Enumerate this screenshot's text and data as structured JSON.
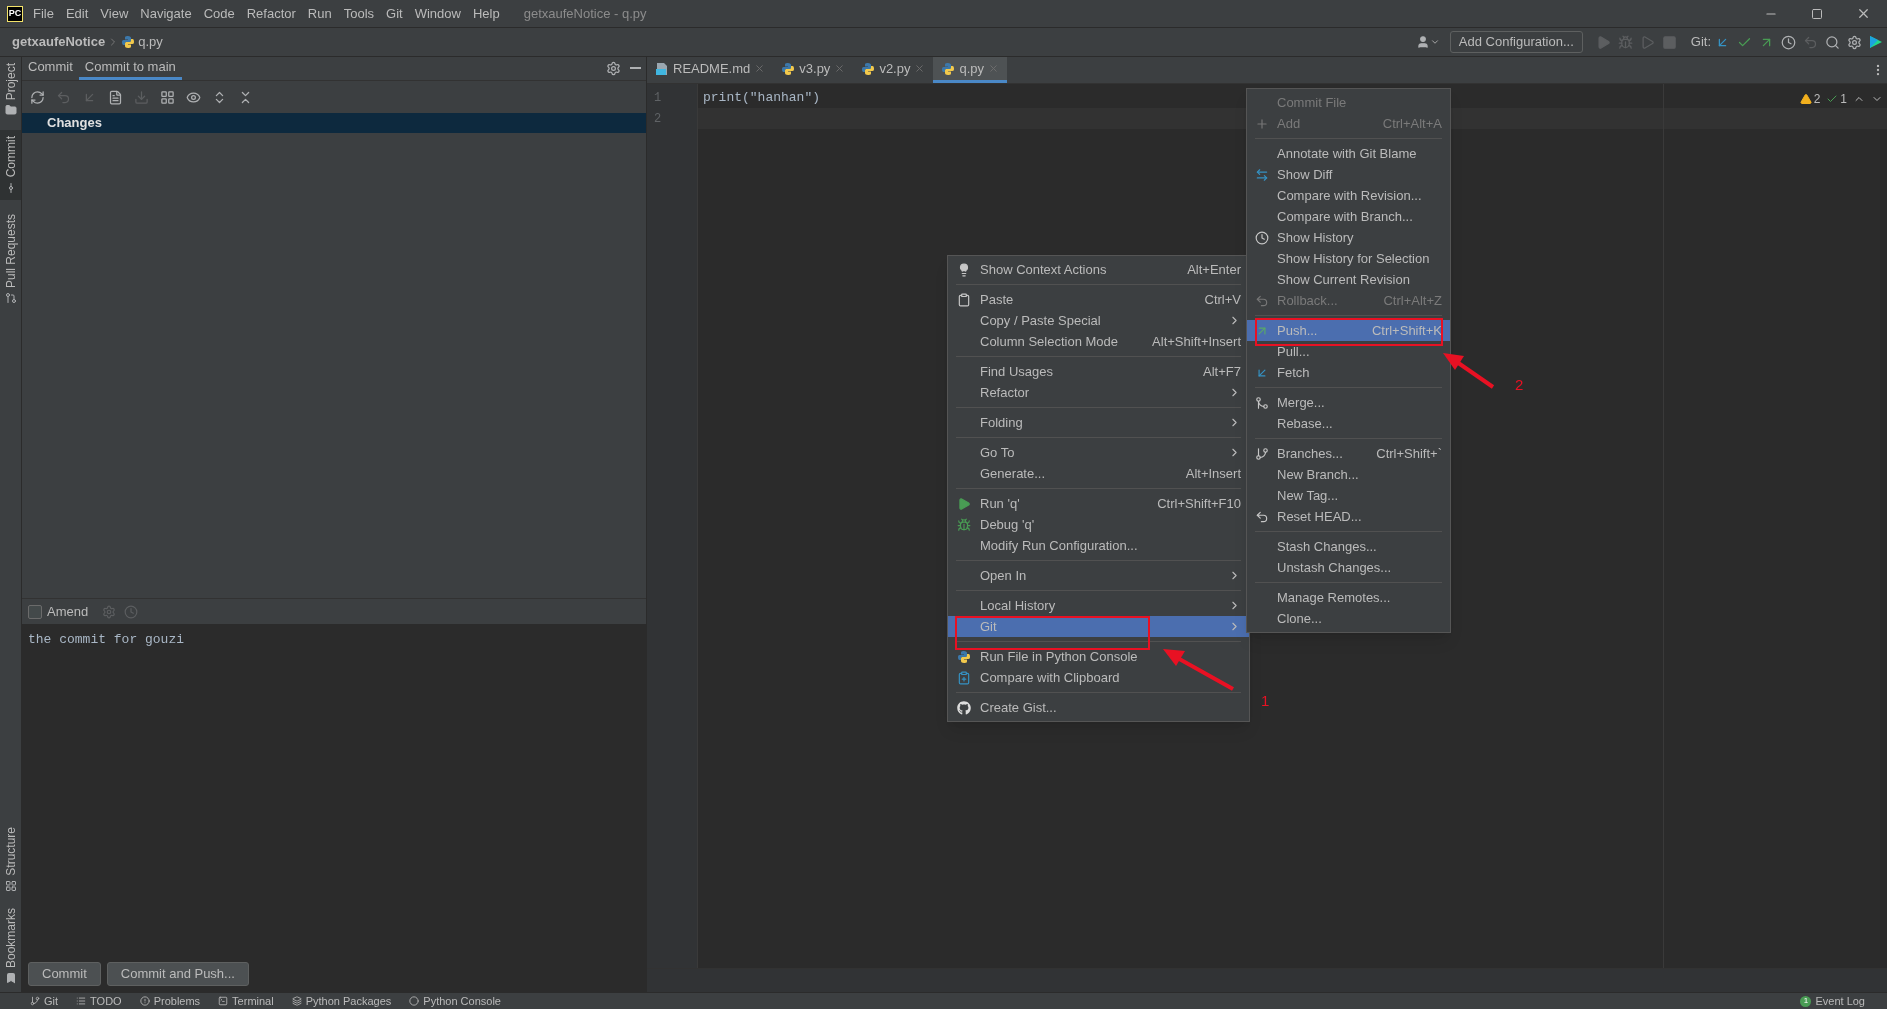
{
  "window": {
    "app_logo": "PC",
    "title": "getxaufeNotice - q.py"
  },
  "menu_bar": [
    "File",
    "Edit",
    "View",
    "Navigate",
    "Code",
    "Refactor",
    "Run",
    "Tools",
    "Git",
    "Window",
    "Help"
  ],
  "breadcrumb": [
    "getxaufeNotice",
    "q.py"
  ],
  "toolbar": {
    "run_config_button": "Add Configuration...",
    "vcs_label": "Git:"
  },
  "side_stripe": {
    "top": [
      {
        "label": "Project",
        "selected": false
      },
      {
        "label": "Commit",
        "selected": true
      },
      {
        "label": "Pull Requests",
        "selected": false
      }
    ],
    "bottom": [
      {
        "label": "Structure",
        "selected": false
      },
      {
        "label": "Bookmarks",
        "selected": false
      }
    ]
  },
  "commit_panel": {
    "tabs": [
      {
        "label": "Commit",
        "selected": false
      },
      {
        "label": "Commit to main",
        "selected": true
      }
    ],
    "tree": [
      {
        "label": "Changes",
        "selected": true
      }
    ],
    "amend": {
      "label": "Amend",
      "checked": false
    },
    "message": "the commit for gouzi",
    "buttons": [
      "Commit",
      "Commit and Push..."
    ]
  },
  "editor": {
    "tabs": [
      {
        "label": "README.md",
        "kind": "markdown",
        "selected": false
      },
      {
        "label": "v3.py",
        "kind": "python",
        "selected": false
      },
      {
        "label": "v2.py",
        "kind": "python",
        "selected": false
      },
      {
        "label": "q.py",
        "kind": "python",
        "selected": true
      }
    ],
    "line_numbers": [
      "1",
      "2"
    ],
    "code": [
      "print(\"hanhan\")"
    ],
    "inspections": {
      "warnings": "2",
      "weak_warnings": "1"
    }
  },
  "context_menu": {
    "groups": [
      [
        {
          "label": "Show Context Actions",
          "shortcut": "Alt+Enter",
          "submenu": false,
          "disabled": false,
          "selected": false
        }
      ],
      [
        {
          "label": "Paste",
          "shortcut": "Ctrl+V",
          "submenu": false,
          "disabled": false,
          "selected": false
        },
        {
          "label": "Copy / Paste Special",
          "submenu": true,
          "disabled": false,
          "selected": false
        },
        {
          "label": "Column Selection Mode",
          "shortcut": "Alt+Shift+Insert",
          "submenu": false,
          "disabled": false,
          "selected": false
        }
      ],
      [
        {
          "label": "Find Usages",
          "shortcut": "Alt+F7",
          "submenu": false,
          "disabled": false,
          "selected": false
        },
        {
          "label": "Refactor",
          "submenu": true,
          "disabled": false,
          "selected": false
        }
      ],
      [
        {
          "label": "Folding",
          "submenu": true,
          "disabled": false,
          "selected": false
        }
      ],
      [
        {
          "label": "Go To",
          "submenu": true,
          "disabled": false,
          "selected": false
        },
        {
          "label": "Generate...",
          "shortcut": "Alt+Insert",
          "submenu": false,
          "disabled": false,
          "selected": false
        }
      ],
      [
        {
          "label": "Run 'q'",
          "shortcut": "Ctrl+Shift+F10",
          "submenu": false,
          "disabled": false,
          "selected": false
        },
        {
          "label": "Debug 'q'",
          "submenu": false,
          "disabled": false,
          "selected": false
        },
        {
          "label": "Modify Run Configuration...",
          "submenu": false,
          "disabled": false,
          "selected": false
        }
      ],
      [
        {
          "label": "Open In",
          "submenu": true,
          "disabled": false,
          "selected": false
        }
      ],
      [
        {
          "label": "Local History",
          "submenu": true,
          "disabled": false,
          "selected": false
        },
        {
          "label": "Git",
          "submenu": true,
          "disabled": false,
          "selected": true
        }
      ],
      [
        {
          "label": "Run File in Python Console",
          "submenu": false,
          "disabled": false,
          "selected": false
        },
        {
          "label": "Compare with Clipboard",
          "submenu": false,
          "disabled": false,
          "selected": false
        }
      ],
      [
        {
          "label": "Create Gist...",
          "submenu": false,
          "disabled": false,
          "selected": false
        }
      ]
    ]
  },
  "git_submenu": {
    "groups": [
      [
        {
          "label": "Commit File",
          "disabled": true,
          "selected": false
        },
        {
          "label": "Add",
          "shortcut": "Ctrl+Alt+A",
          "disabled": true,
          "selected": false
        }
      ],
      [
        {
          "label": "Annotate with Git Blame",
          "disabled": false,
          "selected": false
        },
        {
          "label": "Show Diff",
          "disabled": false,
          "selected": false
        },
        {
          "label": "Compare with Revision...",
          "disabled": false,
          "selected": false
        },
        {
          "label": "Compare with Branch...",
          "disabled": false,
          "selected": false
        },
        {
          "label": "Show History",
          "disabled": false,
          "selected": false
        },
        {
          "label": "Show History for Selection",
          "disabled": false,
          "selected": false
        },
        {
          "label": "Show Current Revision",
          "disabled": false,
          "selected": false
        },
        {
          "label": "Rollback...",
          "shortcut": "Ctrl+Alt+Z",
          "disabled": true,
          "selected": false
        }
      ],
      [
        {
          "label": "Push...",
          "shortcut": "Ctrl+Shift+K",
          "disabled": false,
          "selected": true
        },
        {
          "label": "Pull...",
          "disabled": false,
          "selected": false
        },
        {
          "label": "Fetch",
          "disabled": false,
          "selected": false
        }
      ],
      [
        {
          "label": "Merge...",
          "disabled": false,
          "selected": false
        },
        {
          "label": "Rebase...",
          "disabled": false,
          "selected": false
        }
      ],
      [
        {
          "label": "Branches...",
          "shortcut": "Ctrl+Shift+`",
          "disabled": false,
          "selected": false
        },
        {
          "label": "New Branch...",
          "disabled": false,
          "selected": false
        },
        {
          "label": "New Tag...",
          "disabled": false,
          "selected": false
        },
        {
          "label": "Reset HEAD...",
          "disabled": false,
          "selected": false
        }
      ],
      [
        {
          "label": "Stash Changes...",
          "disabled": false,
          "selected": false
        },
        {
          "label": "Unstash Changes...",
          "disabled": false,
          "selected": false
        }
      ],
      [
        {
          "label": "Manage Remotes...",
          "disabled": false,
          "selected": false
        },
        {
          "label": "Clone...",
          "disabled": false,
          "selected": false
        }
      ]
    ]
  },
  "annotations": [
    "1",
    "2"
  ],
  "tool_window_bar": [
    "Git",
    "TODO",
    "Problems",
    "Terminal",
    "Python Packages",
    "Python Console"
  ],
  "event_log": {
    "label": "Event Log",
    "count": "1"
  }
}
